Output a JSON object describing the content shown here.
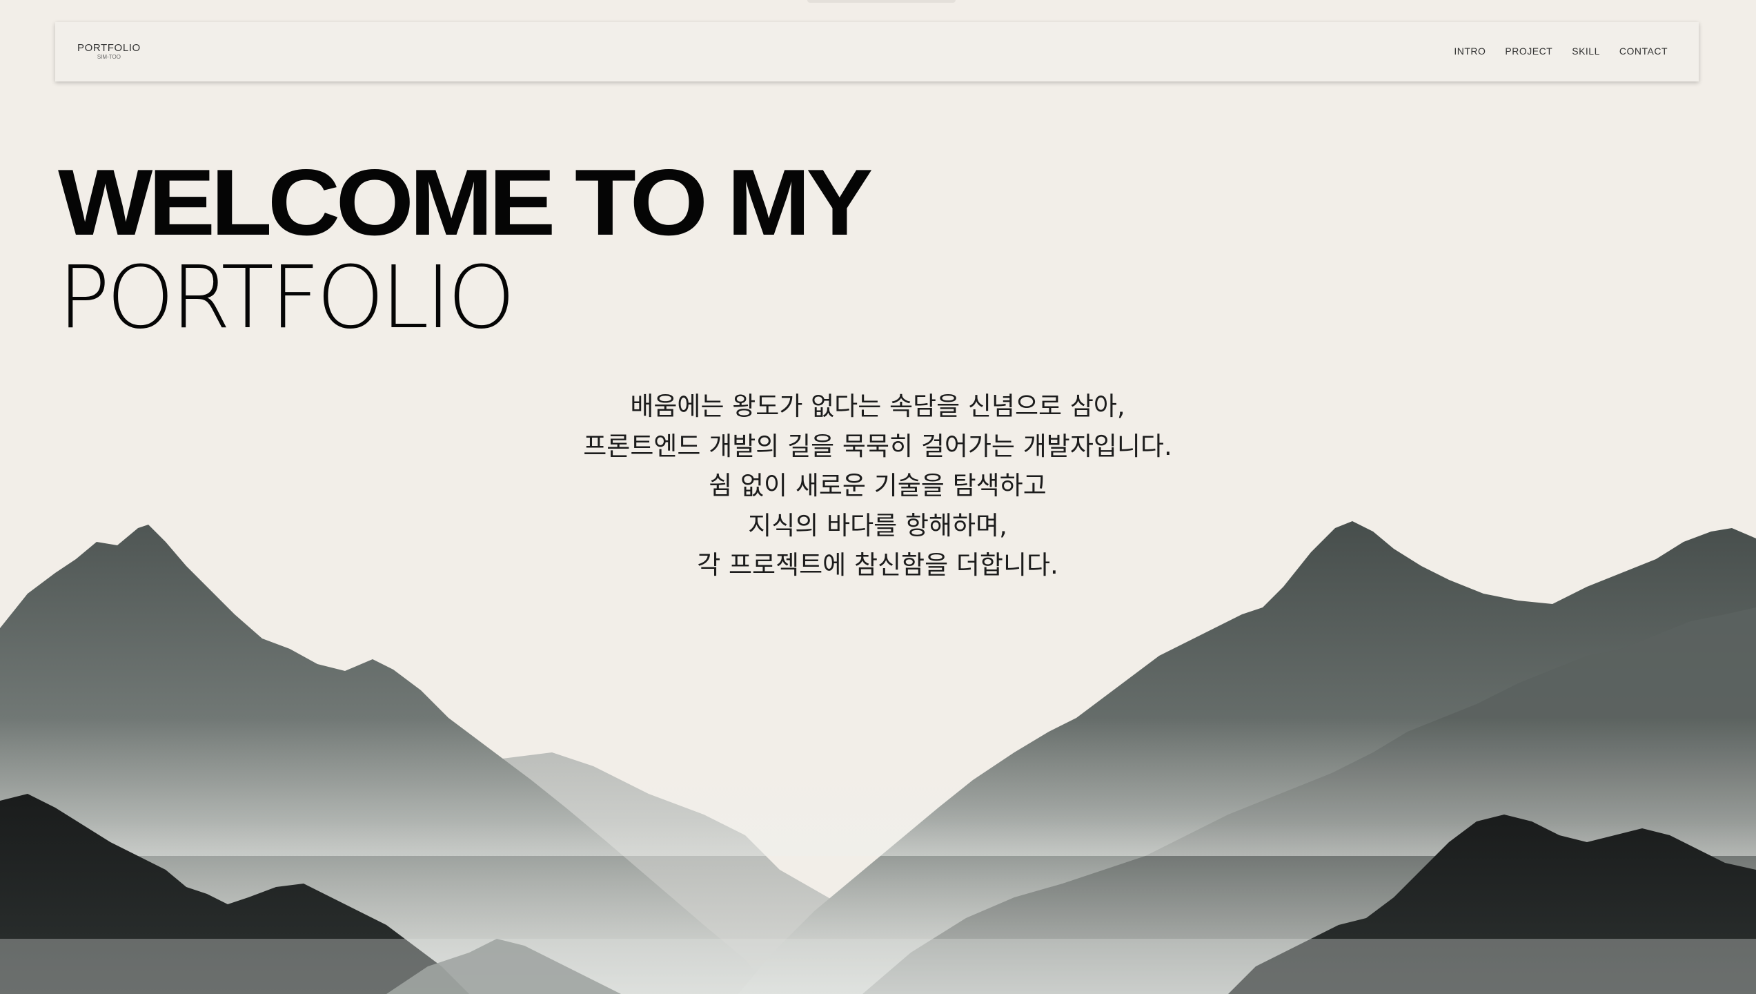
{
  "nav": {
    "logo_title": "PORTFOLIO",
    "logo_subtitle": "SIM-TOO",
    "menu": [
      {
        "label": "INTRO"
      },
      {
        "label": "PROJECT"
      },
      {
        "label": "SKILL"
      },
      {
        "label": "CONTACT"
      }
    ]
  },
  "hero": {
    "title_line1": "WELCOME TO MY",
    "title_line2": "PORTFOLIO"
  },
  "intro": {
    "lines": [
      "배움에는 왕도가 없다는 속담을 신념으로 삼아,",
      "프론트엔드 개발의 길을 묵묵히 걸어가는 개발자입니다.",
      "쉼 없이 새로운 기술을 탐색하고",
      "지식의 바다를 항해하며,",
      "각 프로젝트에 참신함을 더합니다."
    ]
  },
  "colors": {
    "background": "#f2eee8",
    "text": "#050505",
    "mountain_far": "#a7aba8",
    "mountain_mid": "#555c5a",
    "mountain_near": "#161818"
  }
}
